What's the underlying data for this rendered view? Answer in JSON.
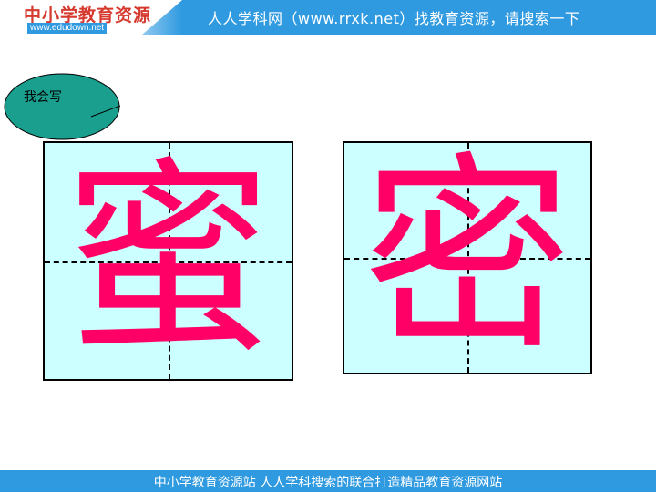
{
  "header": {
    "logo_title": "中小学教育资源",
    "logo_url": "www.edudown.net",
    "banner_text": "人人学科网（www.rrxk.net）找教育资源，请搜索一下"
  },
  "bubble": {
    "label": "我会写"
  },
  "characters": [
    "蜜",
    "密"
  ],
  "footer": {
    "text": "中小学教育资源站 人人学科搜索的联合打造精品教育资源网站"
  },
  "colors": {
    "banner_blue": "#2f9ae0",
    "grid_fill": "#ccffff",
    "char_color": "#ff0066",
    "bubble_fill": "#1a9e8e"
  }
}
